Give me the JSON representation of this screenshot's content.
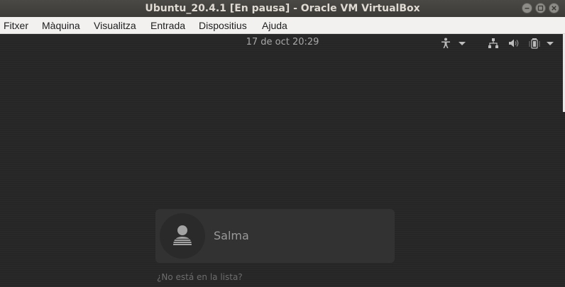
{
  "window": {
    "title": "Ubuntu_20.4.1 [En pausa] - Oracle VM VirtualBox"
  },
  "menubar": {
    "items": [
      "Fitxer",
      "Màquina",
      "Visualitza",
      "Entrada",
      "Dispositius",
      "Ajuda"
    ]
  },
  "topbar": {
    "datetime": "17 de oct  20:29",
    "icons": [
      "accessibility-icon",
      "dropdown-arrow-icon",
      "network-icon",
      "volume-icon",
      "battery-icon",
      "system-menu-arrow-icon"
    ]
  },
  "login": {
    "users": [
      {
        "name": "Salma"
      }
    ],
    "not_listed": "¿No está en la lista?"
  },
  "colors": {
    "titlebar": "#3c3b37",
    "menubar": "#f2f1f0",
    "screen": "#262626",
    "card": "#323232"
  }
}
